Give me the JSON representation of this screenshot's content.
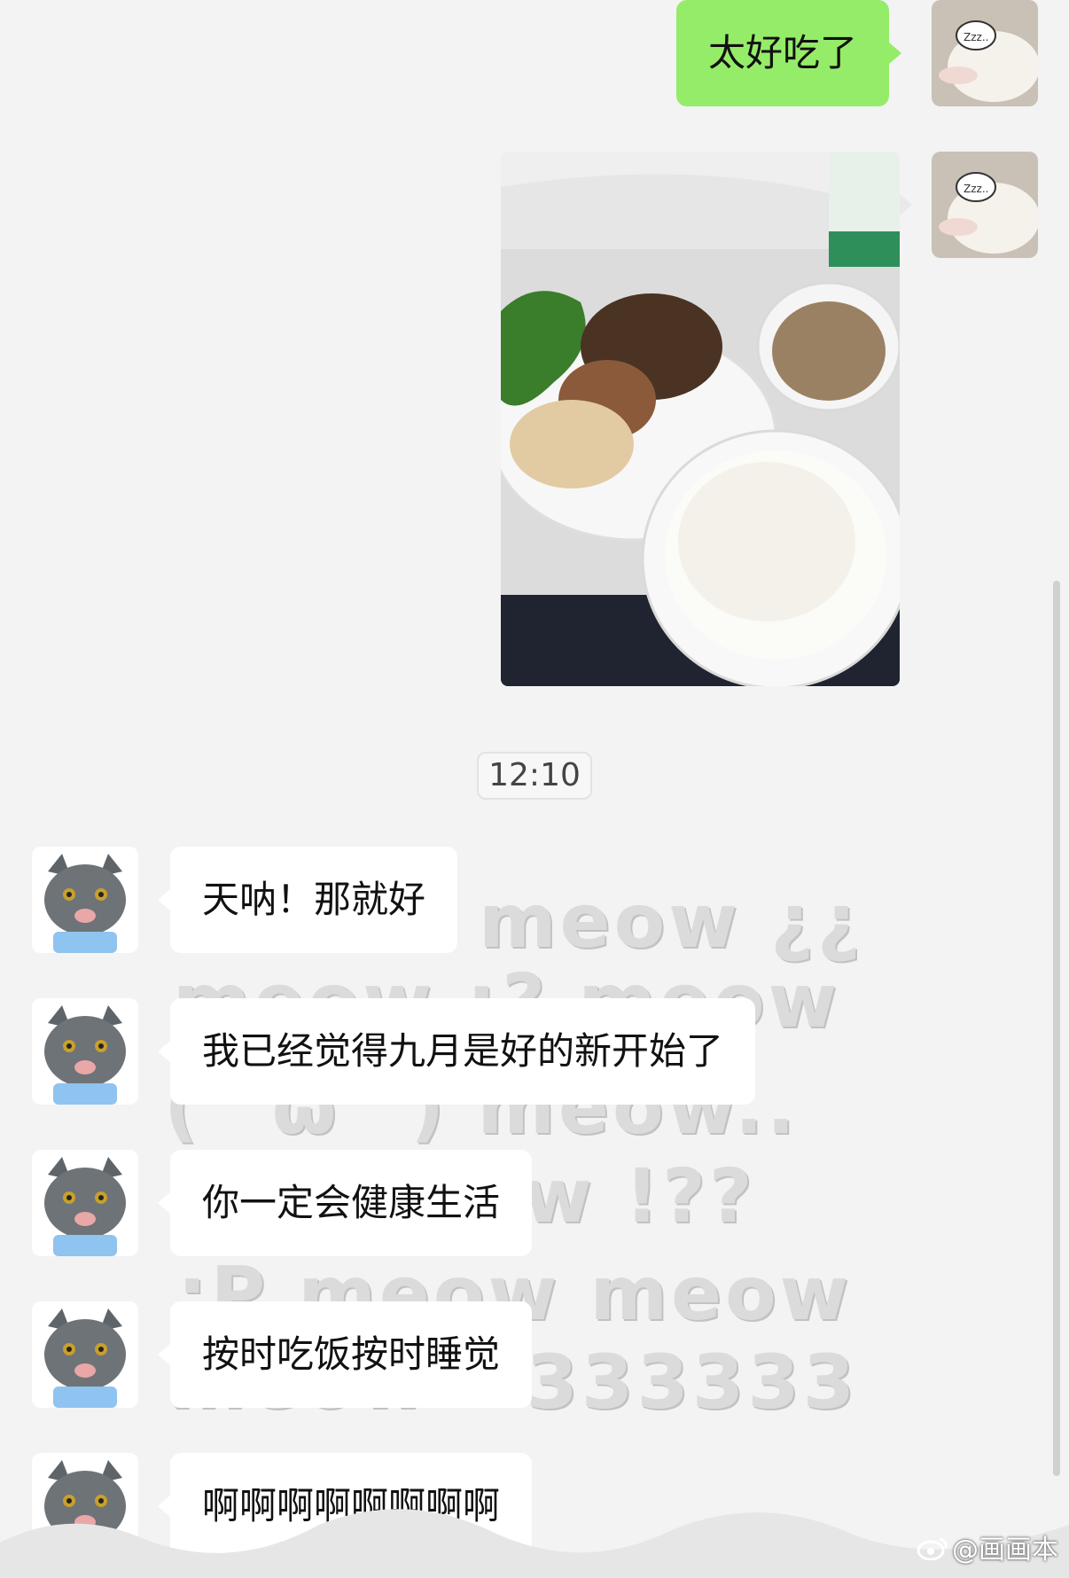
{
  "background_doodle": [
    "meow ¿¿",
    "meow ¡? meow",
    "( ´ω` )  meow..",
    "w      !??",
    ":P meow    meow",
    "meow  <333333"
  ],
  "messages": [
    {
      "side": "right",
      "type": "text",
      "text": "太好吃了",
      "avatar": "sleeping-bunny"
    },
    {
      "side": "right",
      "type": "image",
      "alt": "lunch-photo",
      "avatar": "sleeping-bunny"
    },
    {
      "type": "timestamp",
      "text": "12:10"
    },
    {
      "side": "left",
      "type": "text",
      "text": "天呐！那就好",
      "avatar": "grey-cat"
    },
    {
      "side": "left",
      "type": "text",
      "text": "我已经觉得九月是好的新开始了",
      "avatar": "grey-cat"
    },
    {
      "side": "left",
      "type": "text",
      "text": "你一定会健康生活",
      "avatar": "grey-cat"
    },
    {
      "side": "left",
      "type": "text",
      "text": "按时吃饭按时睡觉",
      "avatar": "grey-cat"
    },
    {
      "side": "left",
      "type": "text",
      "text": "啊啊啊啊啊啊啊啊",
      "avatar": "grey-cat"
    }
  ],
  "watermark": "@画画本",
  "colors": {
    "sent_bubble": "#95ec69",
    "received_bubble": "#ffffff",
    "background": "#f3f3f3"
  }
}
